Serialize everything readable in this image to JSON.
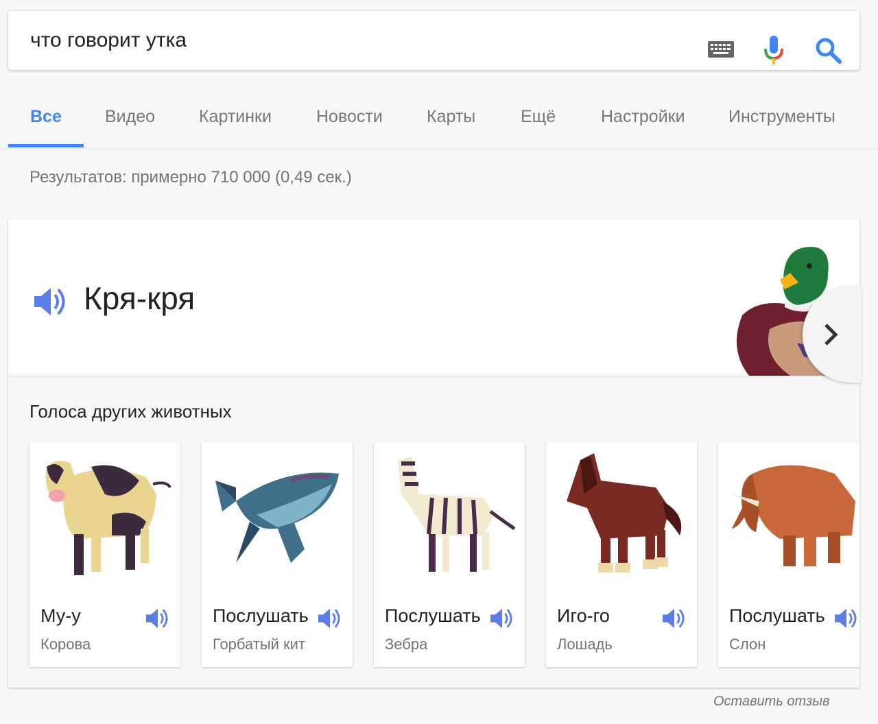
{
  "search": {
    "query": "что говорит утка"
  },
  "tabs": [
    {
      "label": "Все"
    },
    {
      "label": "Видео"
    },
    {
      "label": "Картинки"
    },
    {
      "label": "Новости"
    },
    {
      "label": "Карты"
    },
    {
      "label": "Ещё"
    },
    {
      "label": "Настройки"
    },
    {
      "label": "Инструменты"
    }
  ],
  "stats": "Результатов: примерно 710 000 (0,49 сек.)",
  "answer": {
    "sound": "Кря-кря",
    "other_title": "Голоса других животных",
    "animals": [
      {
        "label": "Му-у",
        "name": "Корова"
      },
      {
        "label": "Послушать",
        "name": "Горбатый кит"
      },
      {
        "label": "Послушать",
        "name": "Зебра"
      },
      {
        "label": "Иго-го",
        "name": "Лошадь"
      },
      {
        "label": "Послушать",
        "name": "Слон"
      }
    ]
  },
  "feedback": "Оставить отзыв",
  "colors": {
    "accent": "#4285f4",
    "speaker": "#5b7ee5"
  }
}
